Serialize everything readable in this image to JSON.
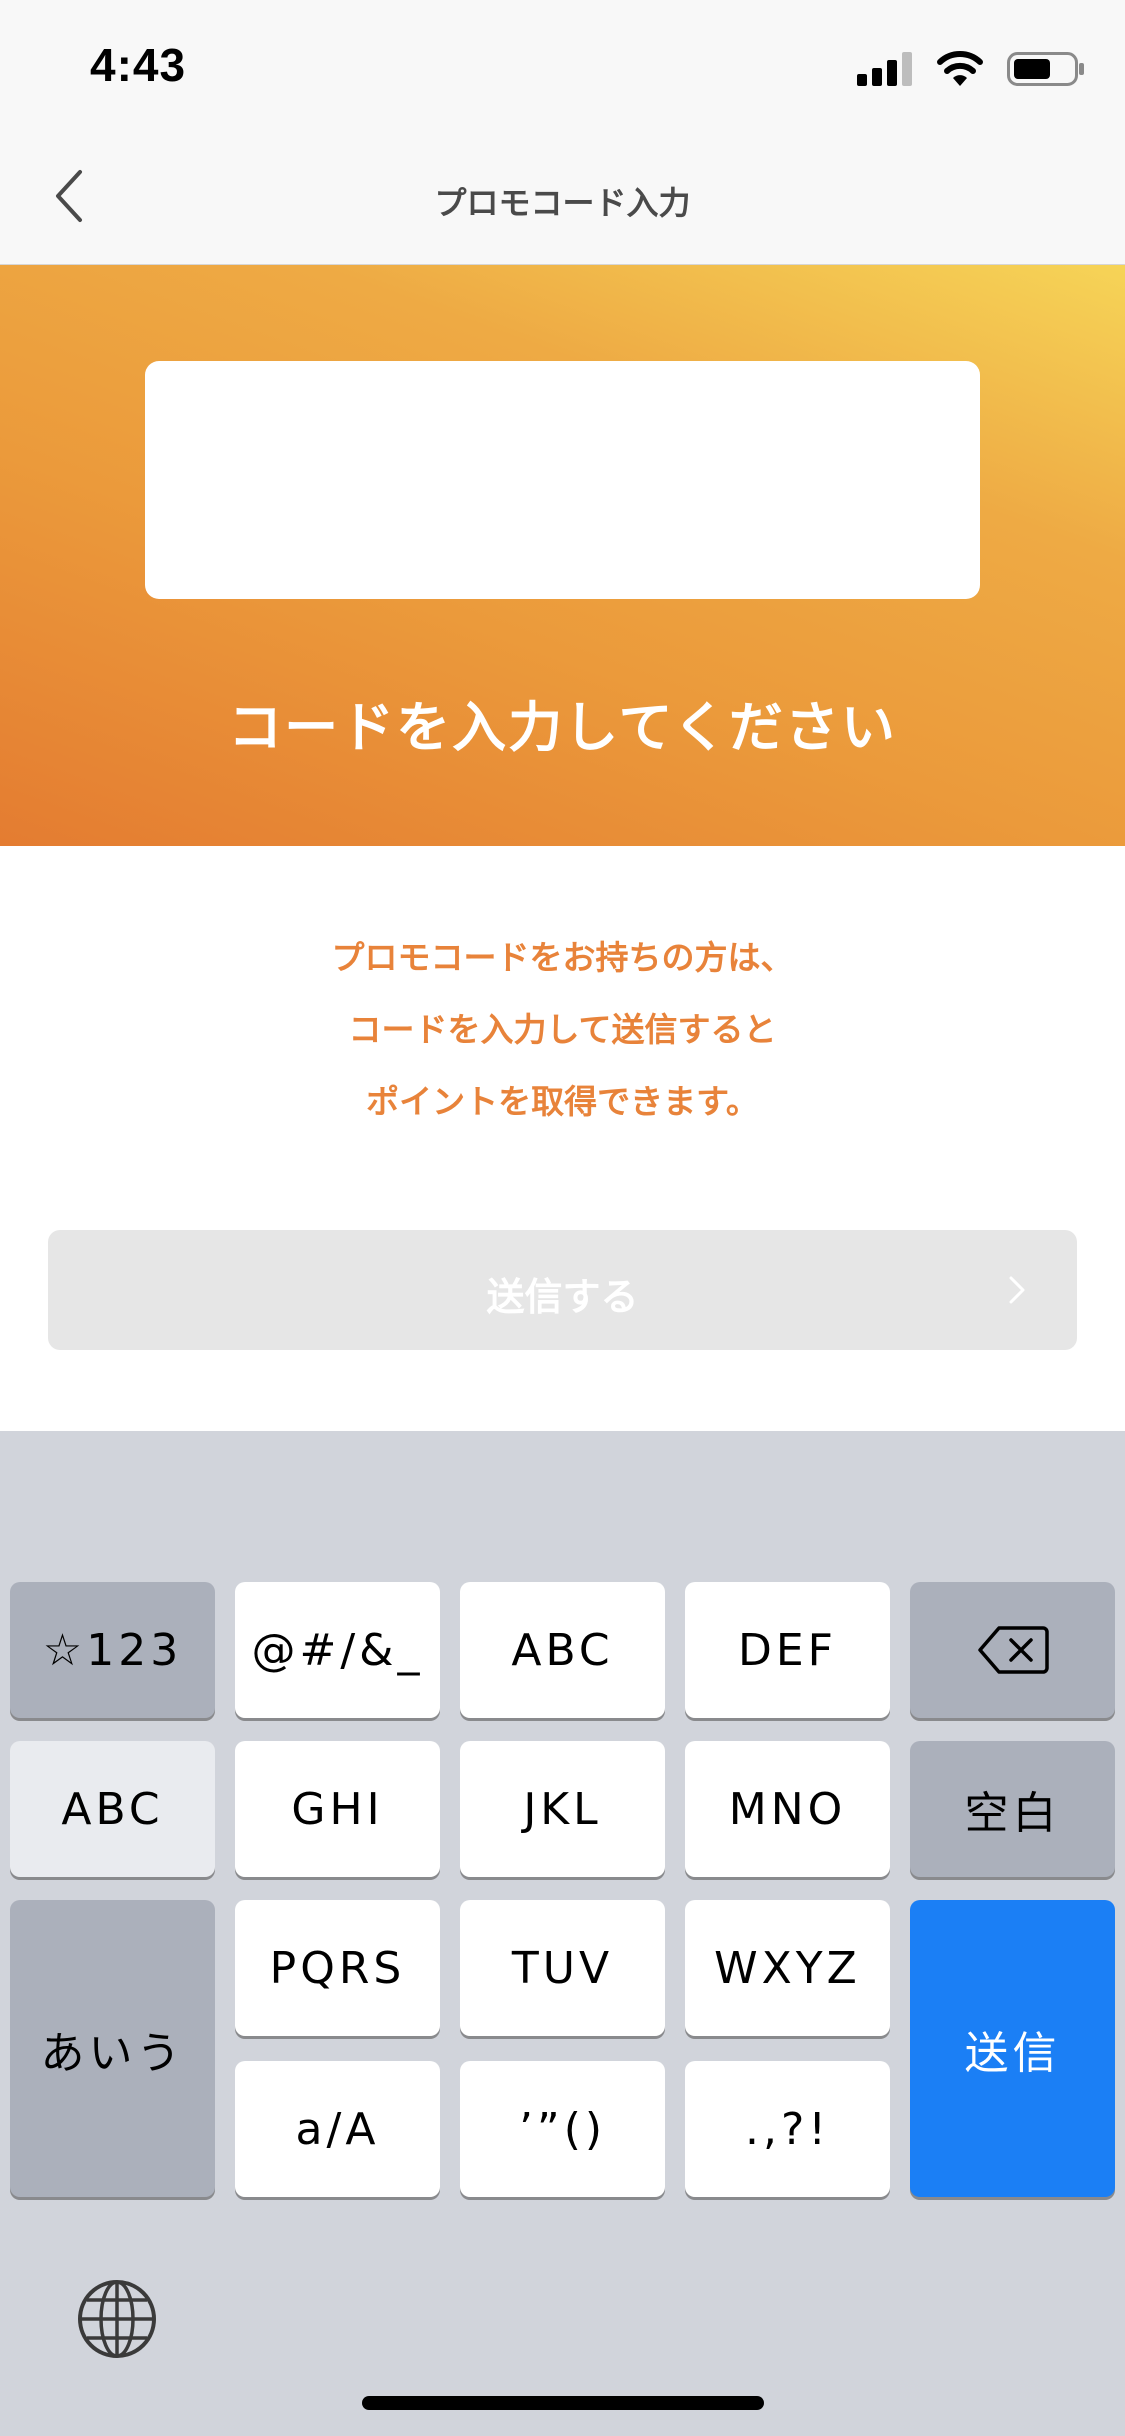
{
  "status_bar": {
    "time": "4:43"
  },
  "nav": {
    "title": "プロモコード入力",
    "back_icon": "chevron-left-icon"
  },
  "hero": {
    "input_value": "",
    "heading": "コードを入力してください",
    "gradient_colors": [
      "#e47c31",
      "#eeaa44",
      "#f6d457"
    ]
  },
  "description": {
    "lines": [
      "プロモコードをお持ちの方は、",
      "コードを入力して送信すると",
      "ポイントを取得できます。"
    ],
    "color": "#e8833a"
  },
  "submit": {
    "label": "送信する",
    "enabled": false,
    "chevron_icon": "chevron-right-icon"
  },
  "keyboard": {
    "row1": [
      "☆123",
      "@#/&_",
      "ABC",
      "DEF",
      "delete-icon"
    ],
    "row2": [
      "ABC",
      "GHI",
      "JKL",
      "MNO",
      "空白"
    ],
    "row3": [
      "あいう",
      "PQRS",
      "TUV",
      "WXYZ",
      "送信"
    ],
    "row4": [
      "a/A",
      "’”()",
      ".,?!"
    ],
    "globe_icon": "globe-icon",
    "return_color": "#1b7ff5"
  }
}
